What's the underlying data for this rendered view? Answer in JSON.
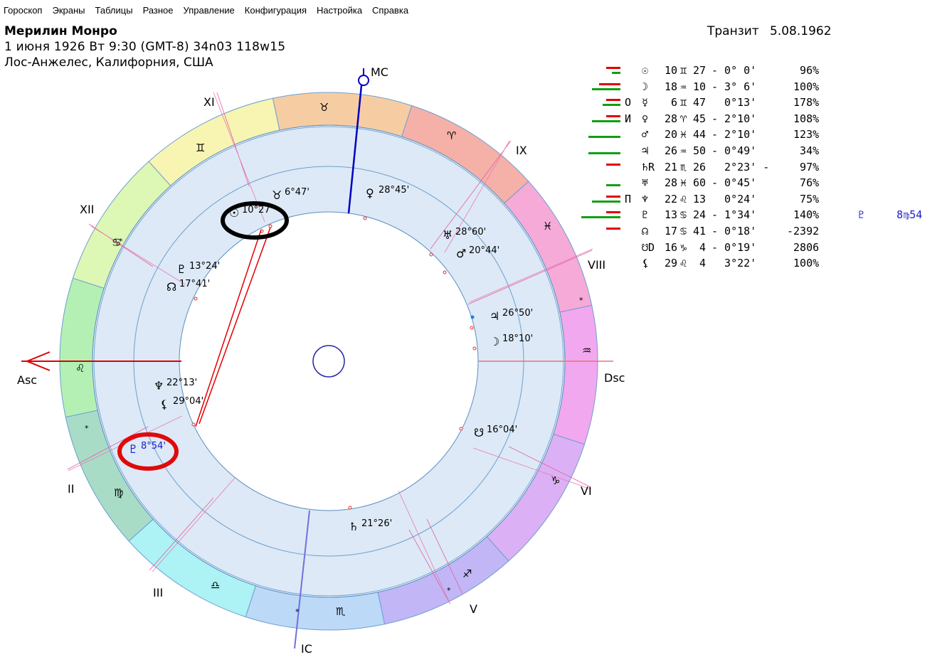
{
  "menu": [
    "Гороскоп",
    "Экраны",
    "Таблицы",
    "Разное",
    "Управление",
    "Конфигурация",
    "Настройка",
    "Справка"
  ],
  "header": {
    "name": "Мерилин Монро",
    "birth": "1 июня 1926  Вт   9:30 (GMT-8) 34n03  118w15",
    "place": "Лос-Анжелес, Калифорния, США",
    "transit_label": "Транзит",
    "transit_date": "5.08.1962"
  },
  "chart": {
    "angles": {
      "mc": "MC",
      "ic": "IC",
      "asc": "Asc",
      "dsc": "Dsc"
    },
    "houses": [
      "XI",
      "XII",
      "II",
      "III",
      "V",
      "VI",
      "VIII",
      "IX"
    ],
    "zodiac_glyphs": [
      "♉",
      "♈",
      "♓",
      "♒",
      "♑",
      "♐",
      "♏",
      "♎",
      "♍",
      "♌",
      "♋",
      "♊"
    ],
    "transit_planets": [
      {
        "glyph": "♉",
        "label": "6°47'"
      },
      {
        "glyph": "☉",
        "label": "10°27'"
      },
      {
        "glyph": "♀",
        "label": "28°45'"
      },
      {
        "glyph": "♅",
        "label": "28°60'"
      },
      {
        "glyph": "♂",
        "label": "20°44'"
      },
      {
        "glyph": "♃",
        "label": "26°50'"
      },
      {
        "glyph": "☽",
        "label": "18°10'"
      },
      {
        "glyph": "♇",
        "label": "13°24'"
      },
      {
        "glyph": "☊",
        "label": "17°41'"
      },
      {
        "glyph": "♆",
        "label": "22°13'"
      },
      {
        "glyph": "⚸",
        "label": "29°04'"
      },
      {
        "glyph": "☋",
        "label": "16°04'"
      },
      {
        "glyph": "♄",
        "label": "21°26'"
      },
      {
        "glyph": "♇",
        "label": "8°54'"
      }
    ]
  },
  "planet_table": [
    {
      "glyph": "☉",
      "sign_glyph": "♊",
      "deg": "10",
      "min": "27",
      "orb": "- 0° 0'",
      "pct": "96%"
    },
    {
      "glyph": "☽",
      "sign_glyph": "♒",
      "deg": "18",
      "min": "10",
      "orb": "- 3° 6'",
      "pct": "100%"
    },
    {
      "glyph": "☿",
      "sign_glyph": "♊",
      "deg": "6",
      "min": "47",
      "orb": "  0°13'",
      "pct": "178%",
      "prefix": "O"
    },
    {
      "glyph": "♀",
      "sign_glyph": "♈",
      "deg": "28",
      "min": "45",
      "orb": "- 2°10'",
      "pct": "108%",
      "prefix": "И"
    },
    {
      "glyph": "♂",
      "sign_glyph": "♓",
      "deg": "20",
      "min": "44",
      "orb": "- 2°10'",
      "pct": "123%"
    },
    {
      "glyph": "♃",
      "sign_glyph": "♒",
      "deg": "26",
      "min": "50",
      "orb": "- 0°49'",
      "pct": "34%"
    },
    {
      "glyph": "♄R",
      "sign_glyph": "♏",
      "deg": "21",
      "min": "26",
      "orb": "  2°23' -",
      "pct": "97%"
    },
    {
      "glyph": "♅",
      "sign_glyph": "♓",
      "deg": "28",
      "min": "60",
      "orb": "- 0°45'",
      "pct": "76%"
    },
    {
      "glyph": "♆",
      "sign_glyph": "♌",
      "deg": "22",
      "min": "13",
      "orb": "  0°24'",
      "pct": "75%",
      "prefix": "П"
    },
    {
      "glyph": "♇",
      "sign_glyph": "♋",
      "deg": "13",
      "min": "24",
      "orb": "- 1°34'",
      "pct": "140%",
      "extra": "♇     8♍54"
    },
    {
      "glyph": "☊",
      "sign_glyph": "♋",
      "deg": "17",
      "min": "41",
      "orb": "- 0°18'",
      "pct": "-2392"
    },
    {
      "glyph": "☋D",
      "sign_glyph": "♑",
      "deg": "16",
      "min": "4",
      "orb": "- 0°19'",
      "pct": "2806"
    },
    {
      "glyph": "⚸",
      "sign_glyph": "♌",
      "deg": "29",
      "min": "4",
      "orb": "  3°22'",
      "pct": "100%"
    }
  ],
  "colors": {
    "accent_red": "#e00000",
    "accent_green": "#11a011",
    "mc_blue": "#0000c0",
    "highlight_red": "#e00a0a"
  }
}
